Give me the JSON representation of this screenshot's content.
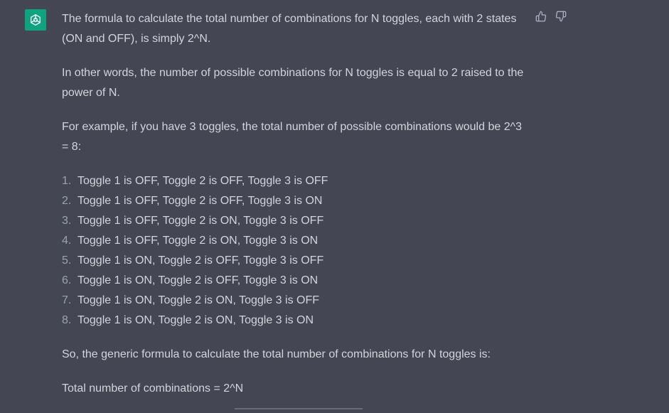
{
  "message": {
    "paragraphs": [
      "The formula to calculate the total number of combinations for N toggles, each with 2 states (ON and OFF), is simply 2^N.",
      "In other words, the number of possible combinations for N toggles is equal to 2 raised to the power of N.",
      "For example, if you have 3 toggles, the total number of possible combinations would be 2^3 = 8:"
    ],
    "list": [
      {
        "num": "1.",
        "text": "Toggle 1 is OFF, Toggle 2 is OFF, Toggle 3 is OFF"
      },
      {
        "num": "2.",
        "text": "Toggle 1 is OFF, Toggle 2 is OFF, Toggle 3 is ON"
      },
      {
        "num": "3.",
        "text": "Toggle 1 is OFF, Toggle 2 is ON, Toggle 3 is OFF"
      },
      {
        "num": "4.",
        "text": "Toggle 1 is OFF, Toggle 2 is ON, Toggle 3 is ON"
      },
      {
        "num": "5.",
        "text": "Toggle 1 is ON, Toggle 2 is OFF, Toggle 3 is OFF"
      },
      {
        "num": "6.",
        "text": "Toggle 1 is ON, Toggle 2 is OFF, Toggle 3 is ON"
      },
      {
        "num": "7.",
        "text": "Toggle 1 is ON, Toggle 2 is ON, Toggle 3 is OFF"
      },
      {
        "num": "8.",
        "text": "Toggle 1 is ON, Toggle 2 is ON, Toggle 3 is ON"
      }
    ],
    "closing": [
      "So, the generic formula to calculate the total number of combinations for N toggles is:",
      "Total number of combinations = 2^N"
    ]
  },
  "icons": {
    "avatar": "openai-logo-icon",
    "thumbs_up": "thumbs-up-icon",
    "thumbs_down": "thumbs-down-icon"
  },
  "colors": {
    "background": "#444654",
    "text": "#d1d5db",
    "avatar_bg": "#10a37f"
  }
}
